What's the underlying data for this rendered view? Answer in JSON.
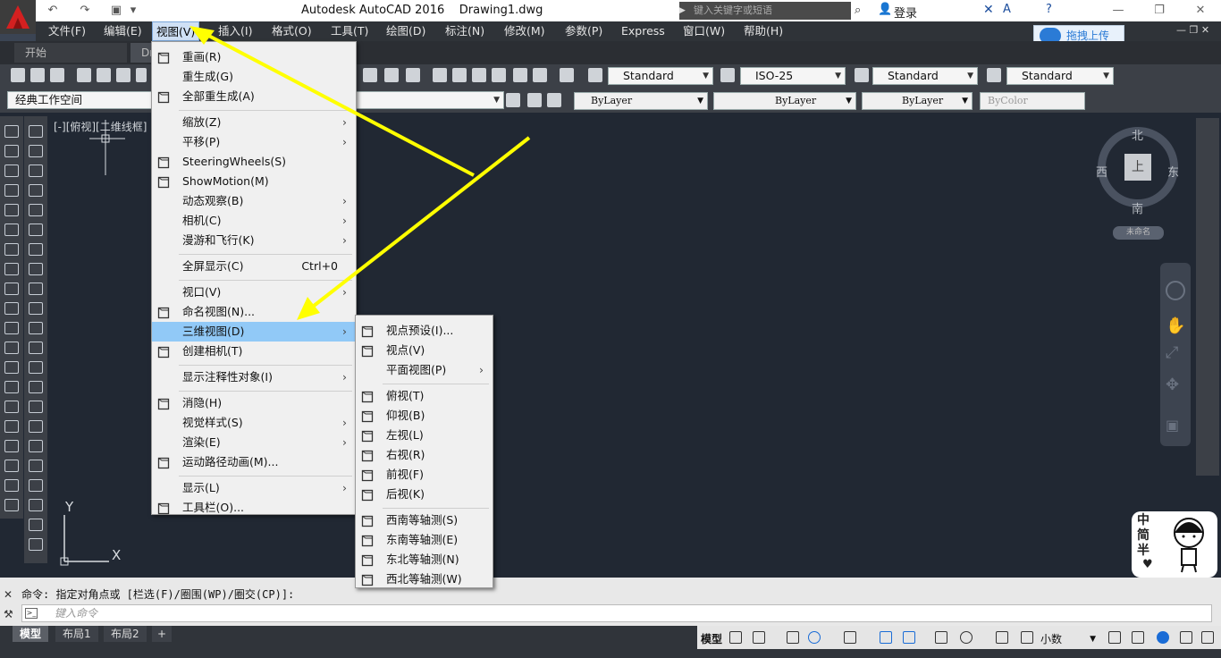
{
  "titlebar": {
    "app_title": "Autodesk AutoCAD 2016",
    "doc_title": "Drawing1.dwg",
    "search_placeholder": "键入关键字或短语",
    "login": "登录"
  },
  "menubar": [
    "文件(F)",
    "编辑(E)",
    "视图(V)",
    "插入(I)",
    "格式(O)",
    "工具(T)",
    "绘图(D)",
    "标注(N)",
    "修改(M)",
    "参数(P)",
    "Express",
    "窗口(W)",
    "帮助(H)"
  ],
  "upload_button": "拖拽上传",
  "doc_tabs": [
    "开始",
    "Dr"
  ],
  "toolbar1": {
    "text_style": "Standard",
    "dim_style": "ISO-25",
    "table_style": "Standard",
    "mleader_style": "Standard"
  },
  "toolbar2": {
    "workspace": "经典工作空间",
    "color": "ByLayer",
    "linetype": "ByLayer",
    "lineweight": "ByLayer",
    "plotstyle": "ByColor"
  },
  "viewport_label": "[-][俯视][二维线框]",
  "viewcube": {
    "north": "北",
    "south": "南",
    "east": "东",
    "west": "西",
    "face": "上",
    "ucs": "未命名"
  },
  "view_menu": [
    {
      "label": "重画(R)",
      "icon": "redraw-icon"
    },
    {
      "label": "重生成(G)"
    },
    {
      "label": "全部重生成(A)",
      "icon": "regen-all-icon"
    },
    {
      "sep": true
    },
    {
      "label": "缩放(Z)",
      "sub": true
    },
    {
      "label": "平移(P)",
      "sub": true
    },
    {
      "label": "SteeringWheels(S)",
      "icon": "steering-wheel-icon"
    },
    {
      "label": "ShowMotion(M)",
      "icon": "showmotion-icon"
    },
    {
      "label": "动态观察(B)",
      "sub": true
    },
    {
      "label": "相机(C)",
      "sub": true
    },
    {
      "label": "漫游和飞行(K)",
      "sub": true
    },
    {
      "sep": true
    },
    {
      "label": "全屏显示(C)",
      "shortcut": "Ctrl+0"
    },
    {
      "sep": true
    },
    {
      "label": "视口(V)",
      "sub": true
    },
    {
      "label": "命名视图(N)...",
      "icon": "named-view-icon"
    },
    {
      "label": "三维视图(D)",
      "sub": true,
      "highlight": true
    },
    {
      "label": "创建相机(T)",
      "icon": "camera-icon"
    },
    {
      "sep": true
    },
    {
      "label": "显示注释性对象(I)",
      "sub": true
    },
    {
      "sep": true
    },
    {
      "label": "消隐(H)",
      "icon": "hide-icon"
    },
    {
      "label": "视觉样式(S)",
      "sub": true
    },
    {
      "label": "渲染(E)",
      "sub": true
    },
    {
      "label": "运动路径动画(M)...",
      "icon": "motion-path-icon"
    },
    {
      "sep": true
    },
    {
      "label": "显示(L)",
      "sub": true
    },
    {
      "label": "工具栏(O)...",
      "icon": "toolbar-icon"
    }
  ],
  "submenu_3d": [
    {
      "label": "视点预设(I)...",
      "icon": "viewpoint-preset-icon"
    },
    {
      "label": "视点(V)",
      "icon": "viewpoint-icon"
    },
    {
      "label": "平面视图(P)",
      "sub": true
    },
    {
      "sep": true
    },
    {
      "label": "俯视(T)",
      "icon": "top-view-icon"
    },
    {
      "label": "仰视(B)",
      "icon": "bottom-view-icon"
    },
    {
      "label": "左视(L)",
      "icon": "left-view-icon"
    },
    {
      "label": "右视(R)",
      "icon": "right-view-icon"
    },
    {
      "label": "前视(F)",
      "icon": "front-view-icon"
    },
    {
      "label": "后视(K)",
      "icon": "back-view-icon"
    },
    {
      "sep": true
    },
    {
      "label": "西南等轴测(S)",
      "icon": "sw-iso-icon"
    },
    {
      "label": "东南等轴测(E)",
      "icon": "se-iso-icon"
    },
    {
      "label": "东北等轴测(N)",
      "icon": "ne-iso-icon"
    },
    {
      "label": "西北等轴测(W)",
      "icon": "nw-iso-icon"
    }
  ],
  "command": {
    "history": "命令: 指定对角点或 [栏选(F)/圈围(WP)/圈交(CP)]:",
    "placeholder": "键入命令"
  },
  "layout_tabs": [
    "模型",
    "布局1",
    "布局2"
  ],
  "status": {
    "model": "模型",
    "scale": "小数"
  },
  "ucs": {
    "x": "X",
    "y": "Y"
  },
  "avatar_text": "中简半",
  "colors": {
    "highlight": "#91c9f7",
    "arrow": "#ffff00",
    "drawing_bg": "#212833"
  }
}
